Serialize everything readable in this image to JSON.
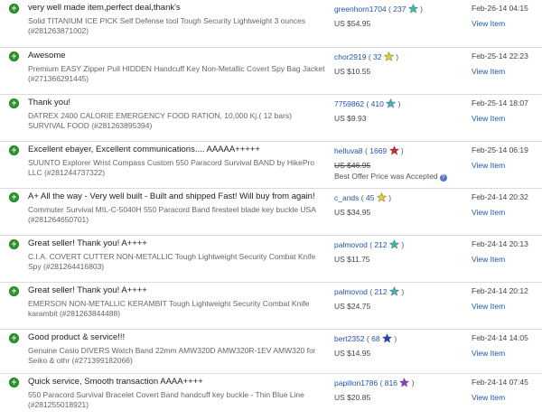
{
  "feedback": [
    {
      "comment": "very well made item,perfect deal,thank's",
      "item": "Solid TITANIUM ICE PICK Self Defense tool Tough Security Lightweight 3 ounces (#281263871002)",
      "buyer": "greenhorn1704",
      "score": "237",
      "star_color": "#3cb8b0",
      "price": "US $54.95",
      "strike": false,
      "best_offer": "",
      "date": "Feb-26-14 04:15",
      "view": "View Item"
    },
    {
      "comment": "Awesome",
      "item": "Premium EASY Zipper Pull HIDDEN Handcuff Key Non-Metallic Covert Spy Bag Jacket (#271366291445)",
      "buyer": "chor2919",
      "score": "32",
      "star_color": "#e8d020",
      "price": "US $10.55",
      "strike": false,
      "best_offer": "",
      "date": "Feb-25-14 22:23",
      "view": "View Item"
    },
    {
      "comment": "Thank you!",
      "item": "DATREX 2400 CALORIE EMERGENCY FOOD RATION, 10,000 Kj.( 12 bars) SURVIVAL FOOD (#281263895394)",
      "buyer": "7759862",
      "score": "410",
      "star_color": "#3cb8b0",
      "price": "US $9.93",
      "strike": false,
      "best_offer": "",
      "date": "Feb-25-14 18:07",
      "view": "View Item"
    },
    {
      "comment": "Excellent ebayer, Excellent communications.... AAAAA+++++",
      "item": "SUUNTO Explorer Wrist Compass Custom 550 Paracord Survival BAND by HikePro LLC (#281244737322)",
      "buyer": "helluva8",
      "score": "1669",
      "star_color": "#d02828",
      "price": "US $46.95",
      "strike": true,
      "best_offer": "Best Offer Price was Accepted",
      "date": "Feb-25-14 06:19",
      "view": "View Item"
    },
    {
      "comment": "A+ All the way - Very well built - Built and shipped Fast! Will buy from again!",
      "item": "Commuter Survival MIL-C-5040H 550 Paracord Band firesteel blade key buckle USA (#281264650701)",
      "buyer": "c_ands",
      "score": "45",
      "star_color": "#e8d020",
      "price": "US $34.95",
      "strike": false,
      "best_offer": "",
      "date": "Feb-24-14 20:32",
      "view": "View Item"
    },
    {
      "comment": "Great seller! Thank you! A++++",
      "item": "C.I.A. COVERT CUTTER NON-METALLIC Tough Lightweight Security Combat Knife Spy (#281264416803)",
      "buyer": "palmovod",
      "score": "212",
      "star_color": "#3cb8b0",
      "price": "US $11.75",
      "strike": false,
      "best_offer": "",
      "date": "Feb-24-14 20:13",
      "view": "View Item"
    },
    {
      "comment": "Great seller! Thank you! A++++",
      "item": "EMERSON NON-METALLIC KERAMBIT Tough Lightweight Security Combat Knife karambit (#281263844488)",
      "buyer": "palmovod",
      "score": "212",
      "star_color": "#3cb8b0",
      "price": "US $24.75",
      "strike": false,
      "best_offer": "",
      "date": "Feb-24-14 20:12",
      "view": "View Item"
    },
    {
      "comment": "Good product & service!!!",
      "item": "Genuine Casio DIVERS Watch Band 22mm AMW320D AMW320R-1EV AMW320 for Seiko & othr (#271399182066)",
      "buyer": "bert2352",
      "score": "68",
      "star_color": "#2040c0",
      "price": "US $14.95",
      "strike": false,
      "best_offer": "",
      "date": "Feb-24-14 14:05",
      "view": "View Item"
    },
    {
      "comment": "Quick service, Smooth transaction AAAA++++",
      "item": "550 Paracord Survival Bracelet Covert Band handcuff key buckle - Thin Blue Line (#281255018921)",
      "buyer": "papillon1786",
      "score": "816",
      "star_color": "#8a3ec8",
      "price": "US $20.85",
      "strike": false,
      "best_offer": "",
      "date": "Feb-24-14 07:45",
      "view": "View Item"
    }
  ]
}
